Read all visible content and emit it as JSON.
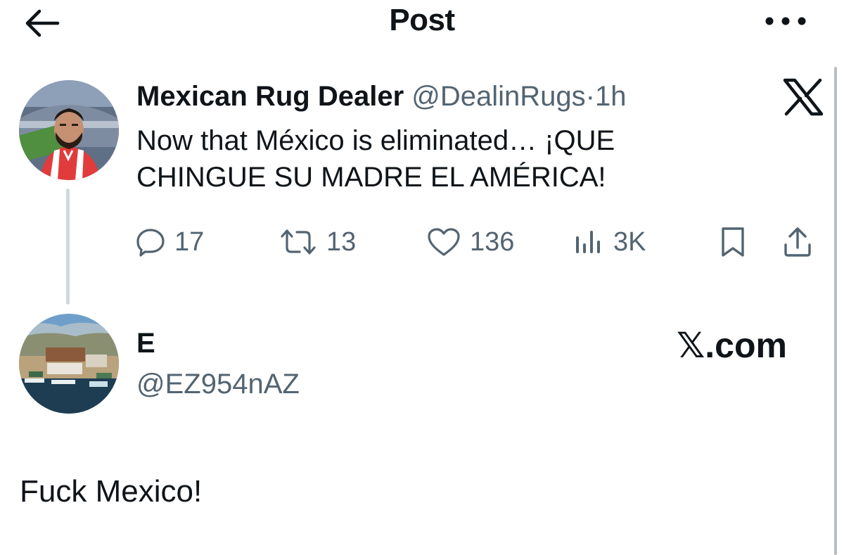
{
  "header": {
    "title": "Post",
    "back_icon": "arrow-left-icon",
    "more_icon": "more-horizontal-icon"
  },
  "tweet": {
    "display_name": "Mexican Rug Dealer",
    "handle": "@DealinRugs",
    "separator": "·",
    "time": "1h",
    "text_line1": "Now that México is eliminated… ¡QUE",
    "text_line2": "CHINGUE SU MADRE EL AMÉRICA!",
    "actions": {
      "replies": "17",
      "retweets": "13",
      "likes": "136",
      "views": "3K"
    },
    "logo_icon": "x-logo-icon"
  },
  "reply": {
    "display_name": "E",
    "handle": "@EZ954nAZ",
    "text": "Fuck Mexico!"
  },
  "watermark": "𝕏.com",
  "colors": {
    "text": "#0f1419",
    "secondary": "#536471",
    "thread_line": "#cfd9de"
  }
}
